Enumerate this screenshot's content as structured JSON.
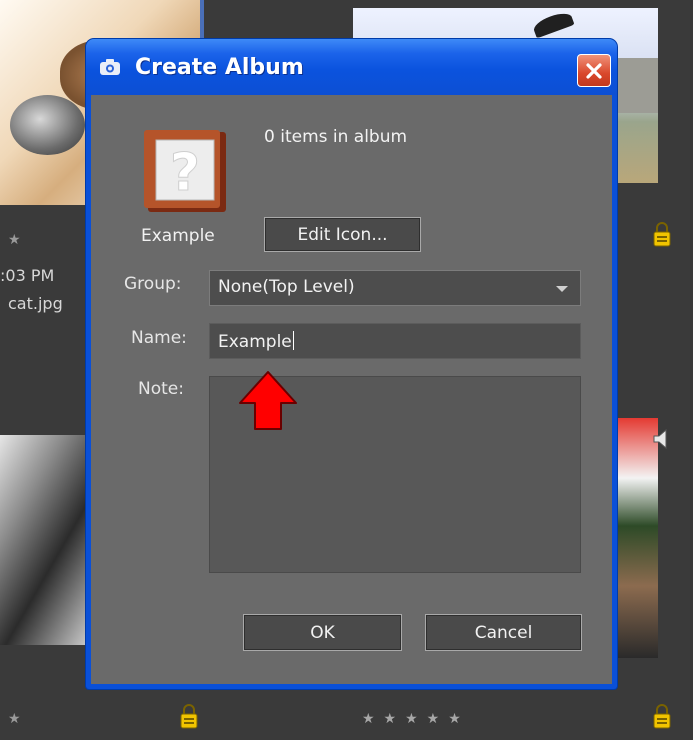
{
  "background": {
    "stamp_time": ":03 PM",
    "file_name": "cat.jpg",
    "photo_stars": "★★★★★",
    "star": "★"
  },
  "dialog": {
    "title": "Create Album",
    "items_count_text": "0 items in album",
    "album_icon_label": "Example",
    "edit_icon_label": "Edit Icon...",
    "group_label": "Group:",
    "group_value": "None(Top Level)",
    "name_label": "Name:",
    "name_value": "Example",
    "note_label": "Note:",
    "note_value": "",
    "ok_label": "OK",
    "cancel_label": "Cancel"
  },
  "colors": {
    "titlebar": "#0b53de",
    "client_bg": "#6a6a6a",
    "close_button": "#d9472b",
    "annotation_arrow": "#ff0000"
  },
  "icons": [
    "camera-icon",
    "close-icon",
    "album-question-icon",
    "dropdown-arrow-icon",
    "lock-icon",
    "star-icon",
    "red-arrow-annotation"
  ]
}
